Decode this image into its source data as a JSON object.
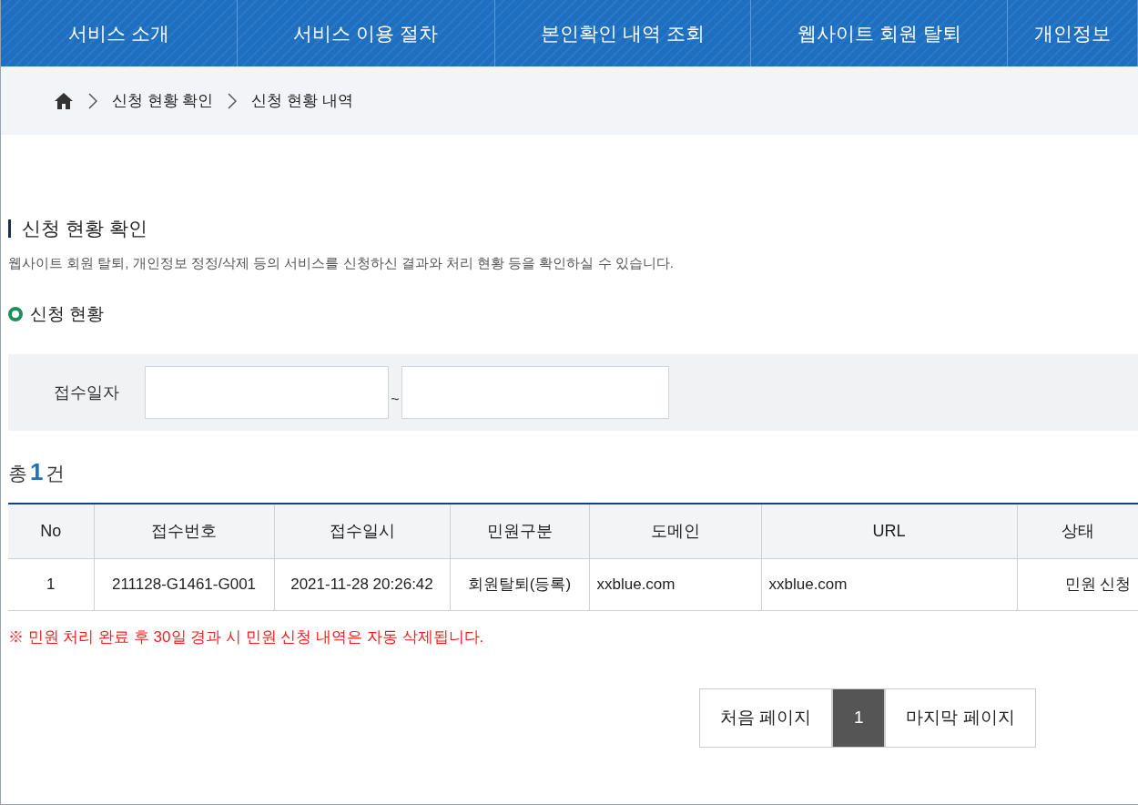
{
  "nav": [
    {
      "label": "서비스 소개"
    },
    {
      "label": "서비스 이용 절차"
    },
    {
      "label": "본인확인 내역 조회"
    },
    {
      "label": "웹사이트 회원 탈퇴"
    },
    {
      "label": "개인정보"
    }
  ],
  "breadcrumb": [
    "신청 현황 확인",
    "신청 현황 내역"
  ],
  "heading": "신청 현황 확인",
  "description": "웹사이트 회원 탈퇴, 개인정보 정정/삭제 등의 서비스를 신청하신 결과와 처리 현황 등을 확인하실 수 있습니다.",
  "subheading": "신청 현황",
  "filter": {
    "label": "접수일자",
    "separator": "~"
  },
  "total": {
    "prefix": "총",
    "count": "1",
    "suffix": "건"
  },
  "table": {
    "columns": [
      "No",
      "접수번호",
      "접수일시",
      "민원구분",
      "도메인",
      "URL",
      "상태"
    ],
    "rows": [
      [
        "1",
        "211128-G1461-G001",
        "2021-11-28 20:26:42",
        "회원탈퇴(등록)",
        "xxblue.com",
        "xxblue.com",
        "민원 신청"
      ]
    ]
  },
  "notice": "※ 민원 처리 완료 후 30일 경과 시 민원 신청 내역은 자동 삭제됩니다.",
  "pagination": [
    {
      "label": "처음 페이지",
      "selected": false
    },
    {
      "label": "1",
      "selected": true
    },
    {
      "label": "마지막 페이지",
      "selected": false
    }
  ]
}
